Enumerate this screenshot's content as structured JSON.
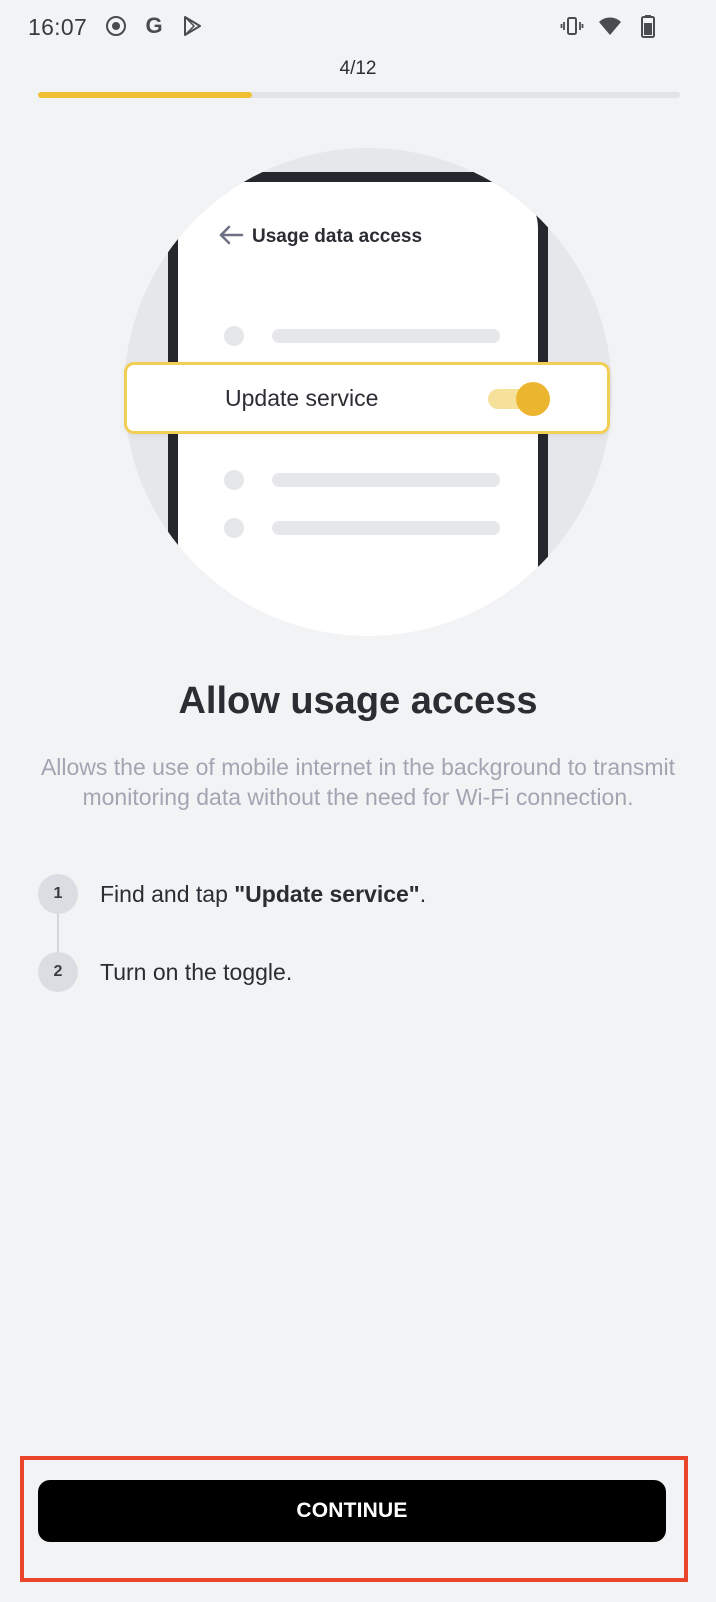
{
  "status_bar": {
    "time": "16:07",
    "left_icons": [
      "record-icon",
      "google-icon",
      "play-store-icon"
    ],
    "right_icons": [
      "vibrate-icon",
      "wifi-icon",
      "battery-icon"
    ]
  },
  "progress": {
    "label": "4/12",
    "fraction": 0.333,
    "accent_color": "#f0c030"
  },
  "illustration": {
    "screen_title": "Usage data access",
    "highlighted_item": "Update service",
    "toggle_on": true
  },
  "heading": "Allow usage access",
  "description": "Allows the use of mobile internet in the background to transmit monitoring data without the need for Wi-Fi connection.",
  "steps": [
    {
      "number": "1",
      "text_before": "Find and tap ",
      "text_bold": "\"Update service\"",
      "text_after": "."
    },
    {
      "number": "2",
      "text": "Turn on the toggle."
    }
  ],
  "continue_button": {
    "label": "CONTINUE",
    "highlight_color": "#e9452a"
  }
}
